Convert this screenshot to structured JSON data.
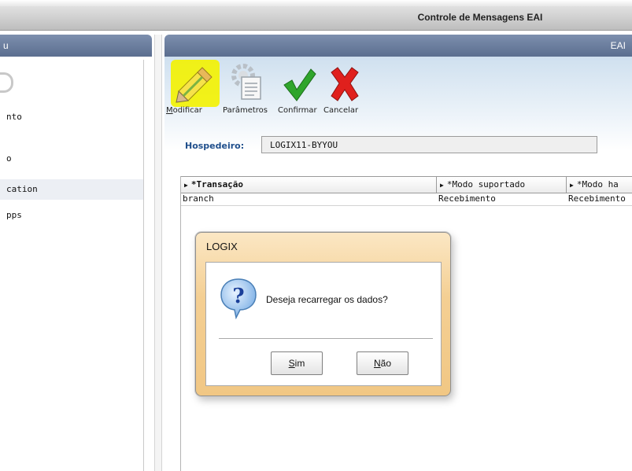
{
  "window": {
    "title": "Controle de Mensagens EAI"
  },
  "left_panel": {
    "header": "u",
    "items": [
      {
        "label": "nto",
        "selected": false
      },
      {
        "label": "o",
        "selected": false
      },
      {
        "label": "cation",
        "selected": true
      },
      {
        "label": "pps",
        "selected": false
      }
    ]
  },
  "right_panel": {
    "header": "EAI"
  },
  "toolbar": {
    "buttons": [
      {
        "first": "M",
        "rest": "odificar",
        "icon": "pencil-icon",
        "active": true
      },
      {
        "first": "",
        "rest": "Parâmetros",
        "icon": "settings-document-icon",
        "active": false
      },
      {
        "first": "",
        "rest": "Confirmar",
        "icon": "checkmark-icon",
        "active": false
      },
      {
        "first": "",
        "rest": "Cancelar",
        "icon": "x-icon",
        "active": false
      }
    ]
  },
  "form": {
    "hospedeiro_label": "Hospedeiro:",
    "hospedeiro_value": "LOGIX11-BYYOU"
  },
  "grid": {
    "columns": [
      "*Transação",
      "*Modo suportado",
      "*Modo ha"
    ],
    "rows": [
      [
        "branch",
        "Recebimento",
        "Recebimento"
      ]
    ]
  },
  "dialog": {
    "title": "LOGIX",
    "message": "Deseja recarregar os dados?",
    "icon": "question-icon",
    "yes_first": "S",
    "yes_rest": "im",
    "no_first": "N",
    "no_rest": "ão"
  },
  "colors": {
    "panel_header": "#5b6e8f",
    "highlight": "#f3f200",
    "label_blue": "#1f4f8c",
    "dialog_frame": "#f4cf93"
  }
}
